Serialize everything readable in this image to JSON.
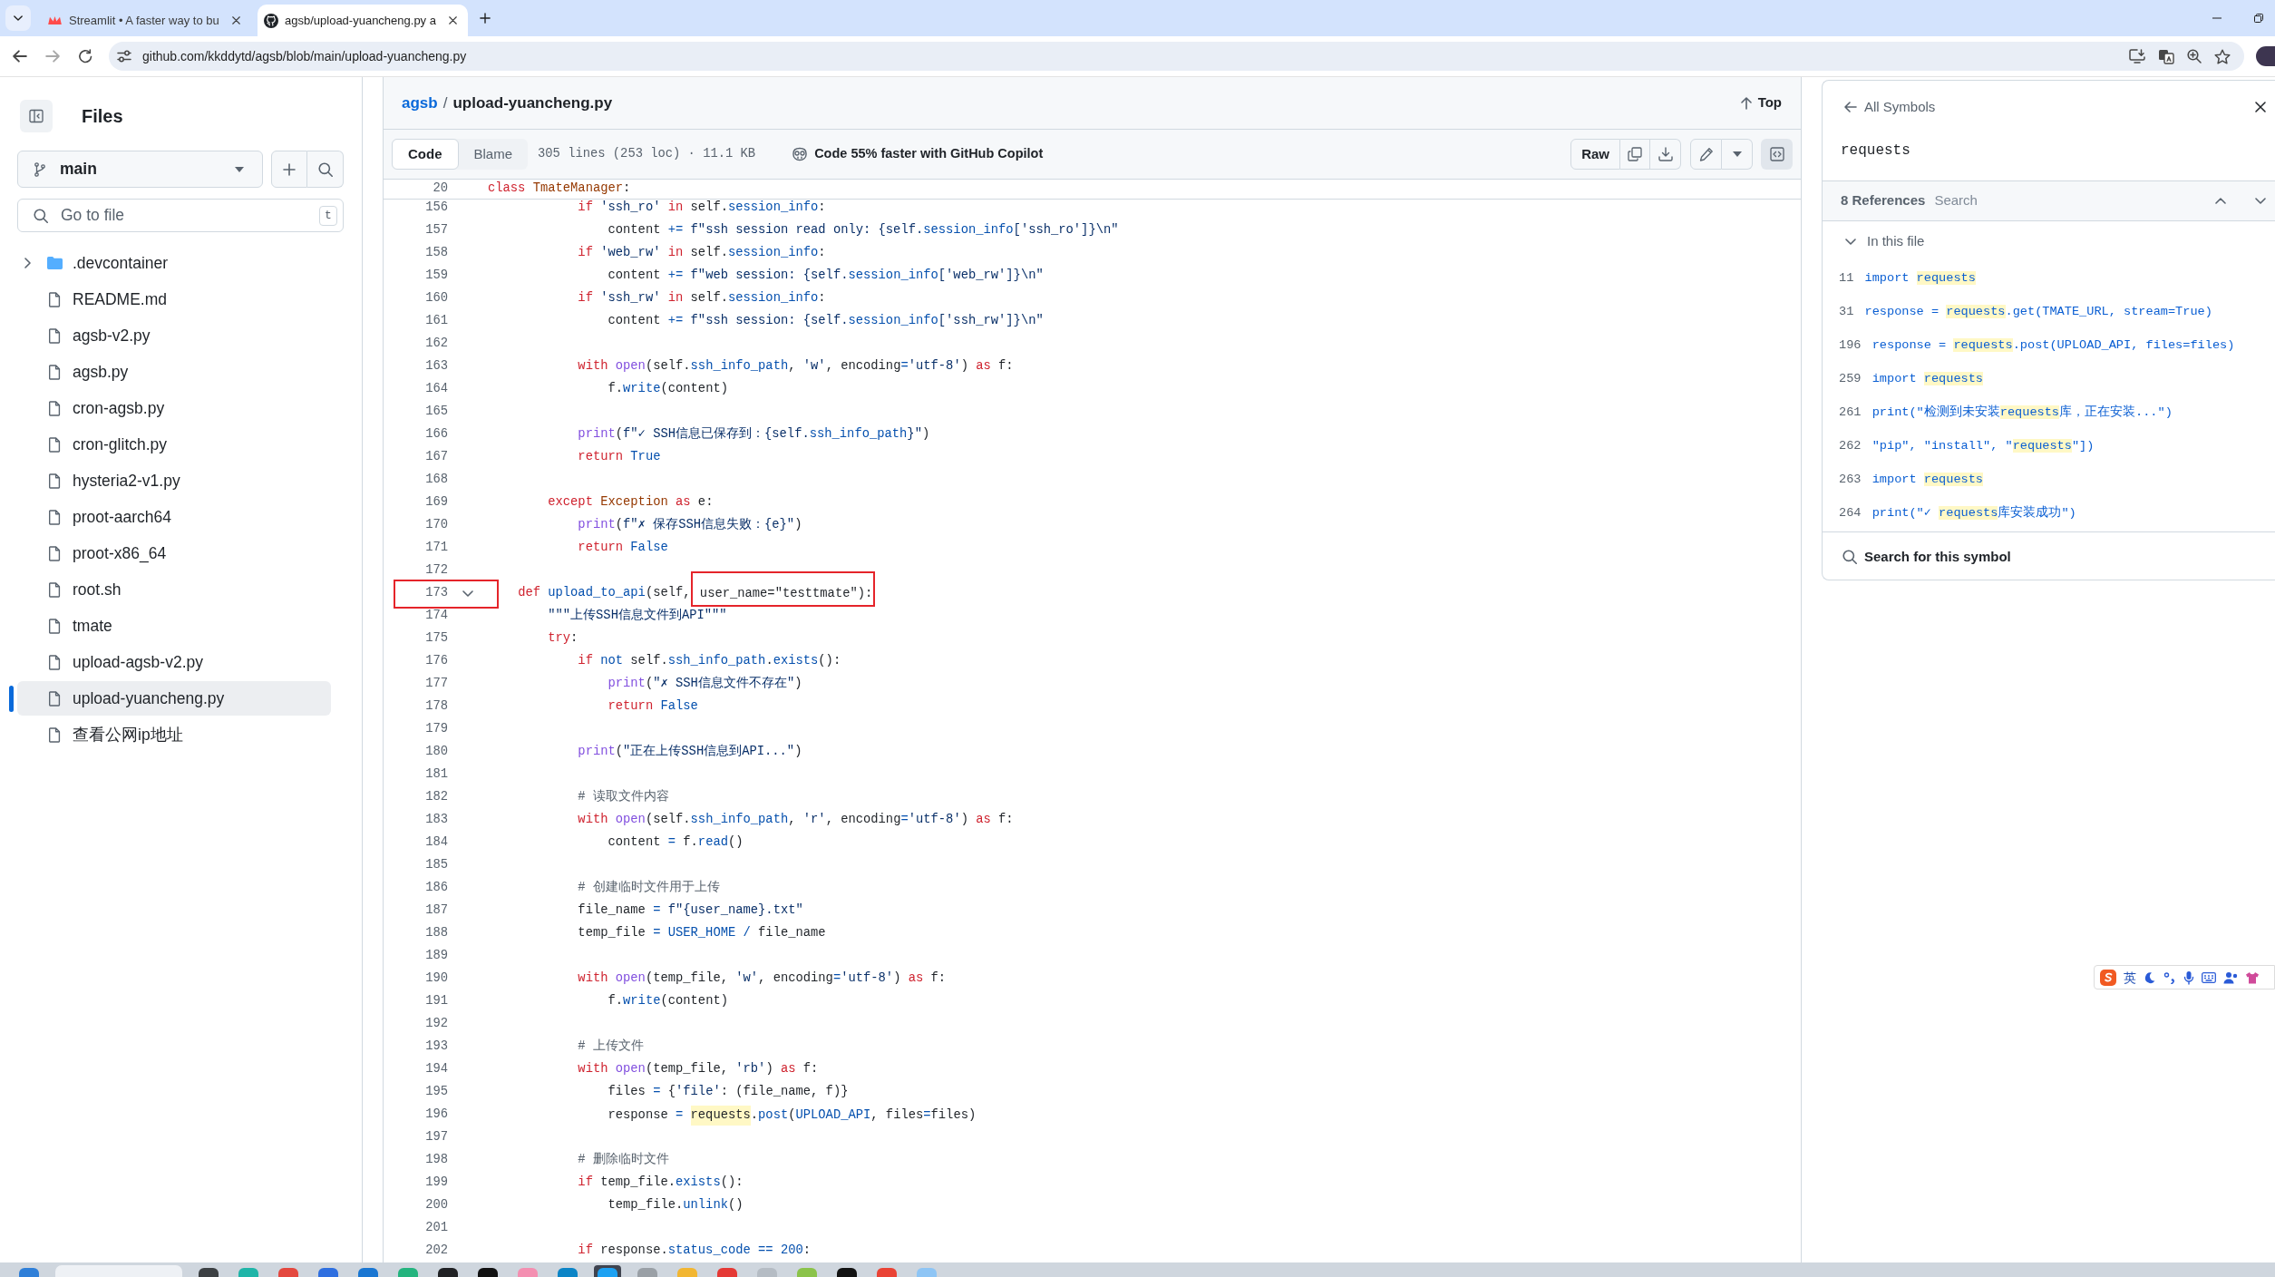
{
  "browser": {
    "tabs": [
      {
        "title": "Streamlit • A faster way to bu",
        "selected": false
      },
      {
        "title": "agsb/upload-yuancheng.py a",
        "selected": true
      }
    ],
    "address": "github.com/kkddytd/agsb/blob/main/upload-yuancheng.py"
  },
  "sidebar": {
    "title": "Files",
    "branch": "main",
    "file_search": {
      "placeholder": "Go to file",
      "shortcut": "t"
    },
    "tree": [
      {
        "name": ".devcontainer",
        "kind": "folder",
        "expanded": false,
        "selected": false
      },
      {
        "name": "README.md",
        "kind": "file",
        "selected": false
      },
      {
        "name": "agsb-v2.py",
        "kind": "file",
        "selected": false
      },
      {
        "name": "agsb.py",
        "kind": "file",
        "selected": false
      },
      {
        "name": "cron-agsb.py",
        "kind": "file",
        "selected": false
      },
      {
        "name": "cron-glitch.py",
        "kind": "file",
        "selected": false
      },
      {
        "name": "hysteria2-v1.py",
        "kind": "file",
        "selected": false
      },
      {
        "name": "proot-aarch64",
        "kind": "file",
        "selected": false
      },
      {
        "name": "proot-x86_64",
        "kind": "file",
        "selected": false
      },
      {
        "name": "root.sh",
        "kind": "file",
        "selected": false
      },
      {
        "name": "tmate",
        "kind": "file",
        "selected": false
      },
      {
        "name": "upload-agsb-v2.py",
        "kind": "file",
        "selected": false
      },
      {
        "name": "upload-yuancheng.py",
        "kind": "file",
        "selected": true
      },
      {
        "name": "查看公网ip地址",
        "kind": "file",
        "selected": false
      }
    ]
  },
  "file_header": {
    "breadcrumb": [
      {
        "label": "agsb",
        "kind": "link"
      },
      {
        "label": "upload-yuancheng.py",
        "kind": "current"
      }
    ],
    "separator": "/",
    "top_link": "Top"
  },
  "toolbar": {
    "view_tabs": [
      {
        "label": "Code",
        "selected": true
      },
      {
        "label": "Blame",
        "selected": false
      }
    ],
    "file_info": "305 lines (253 loc) · 11.1 KB",
    "copilot_promo": "Code 55% faster with GitHub Copilot",
    "raw_button": "Raw",
    "symbols_button": {
      "selected": true
    }
  },
  "code": {
    "sticky_line": {
      "number": "20",
      "tokens": [
        {
          "text": "class ",
          "kind": "keyword"
        },
        {
          "text": "TmateManager",
          "kind": "class"
        },
        {
          "text": ":",
          "kind": "plain"
        }
      ]
    },
    "lines": [
      {
        "number": "156",
        "tokens": [
          {
            "text": "            if",
            "kind": "keyword"
          },
          {
            "text": " 'ssh_ro' ",
            "kind": "string"
          },
          {
            "text": "in",
            "kind": "keyword"
          },
          {
            "text": " self.",
            "kind": "plain"
          },
          {
            "text": "session_info",
            "kind": "entity"
          },
          {
            "text": ":",
            "kind": "plain"
          }
        ]
      },
      {
        "number": "157",
        "tokens": [
          {
            "text": "                content ",
            "kind": "plain"
          },
          {
            "text": "+=",
            "kind": "entity"
          },
          {
            "text": " f\"ssh session read only: {self.",
            "kind": "string"
          },
          {
            "text": "session_info",
            "kind": "entity"
          },
          {
            "text": "['ssh_ro']}\\n\"",
            "kind": "string"
          }
        ]
      },
      {
        "number": "158",
        "tokens": [
          {
            "text": "            if",
            "kind": "keyword"
          },
          {
            "text": " 'web_rw' ",
            "kind": "string"
          },
          {
            "text": "in",
            "kind": "keyword"
          },
          {
            "text": " self.",
            "kind": "plain"
          },
          {
            "text": "session_info",
            "kind": "entity"
          },
          {
            "text": ":",
            "kind": "plain"
          }
        ]
      },
      {
        "number": "159",
        "tokens": [
          {
            "text": "                content ",
            "kind": "plain"
          },
          {
            "text": "+=",
            "kind": "entity"
          },
          {
            "text": " f\"web session: {self.",
            "kind": "string"
          },
          {
            "text": "session_info",
            "kind": "entity"
          },
          {
            "text": "['web_rw']}\\n\"",
            "kind": "string"
          }
        ]
      },
      {
        "number": "160",
        "tokens": [
          {
            "text": "            if",
            "kind": "keyword"
          },
          {
            "text": " 'ssh_rw' ",
            "kind": "string"
          },
          {
            "text": "in",
            "kind": "keyword"
          },
          {
            "text": " self.",
            "kind": "plain"
          },
          {
            "text": "session_info",
            "kind": "entity"
          },
          {
            "text": ":",
            "kind": "plain"
          }
        ]
      },
      {
        "number": "161",
        "tokens": [
          {
            "text": "                content ",
            "kind": "plain"
          },
          {
            "text": "+=",
            "kind": "entity"
          },
          {
            "text": " f\"ssh session: {self.",
            "kind": "string"
          },
          {
            "text": "session_info",
            "kind": "entity"
          },
          {
            "text": "['ssh_rw']}\\n\"",
            "kind": "string"
          }
        ]
      },
      {
        "number": "162"
      },
      {
        "number": "163",
        "tokens": [
          {
            "text": "            with ",
            "kind": "keyword"
          },
          {
            "text": "open",
            "kind": "builtin"
          },
          {
            "text": "(self.",
            "kind": "plain"
          },
          {
            "text": "ssh_info_path",
            "kind": "entity"
          },
          {
            "text": ", ",
            "kind": "plain"
          },
          {
            "text": "'w'",
            "kind": "string"
          },
          {
            "text": ", encoding",
            "kind": "plain"
          },
          {
            "text": "=",
            "kind": "entity"
          },
          {
            "text": "'utf-8'",
            "kind": "string"
          },
          {
            "text": ") ",
            "kind": "plain"
          },
          {
            "text": "as",
            "kind": "keyword"
          },
          {
            "text": " f:",
            "kind": "plain"
          }
        ]
      },
      {
        "number": "164",
        "tokens": [
          {
            "text": "                f.",
            "kind": "plain"
          },
          {
            "text": "write",
            "kind": "entity"
          },
          {
            "text": "(content)",
            "kind": "plain"
          }
        ]
      },
      {
        "number": "165"
      },
      {
        "number": "166",
        "tokens": [
          {
            "text": "            print",
            "kind": "builtin"
          },
          {
            "text": "(",
            "kind": "plain"
          },
          {
            "text": "f\"✓ SSH信息已保存到：{self.",
            "kind": "string"
          },
          {
            "text": "ssh_info_path",
            "kind": "entity"
          },
          {
            "text": "}\"",
            "kind": "string"
          },
          {
            "text": ")",
            "kind": "plain"
          }
        ]
      },
      {
        "number": "167",
        "tokens": [
          {
            "text": "            return ",
            "kind": "keyword"
          },
          {
            "text": "True",
            "kind": "entity"
          }
        ]
      },
      {
        "number": "168"
      },
      {
        "number": "169",
        "tokens": [
          {
            "text": "        except ",
            "kind": "keyword"
          },
          {
            "text": "Exception",
            "kind": "class"
          },
          {
            "text": " as",
            "kind": "keyword"
          },
          {
            "text": " e:",
            "kind": "plain"
          }
        ]
      },
      {
        "number": "170",
        "tokens": [
          {
            "text": "            print",
            "kind": "builtin"
          },
          {
            "text": "(",
            "kind": "plain"
          },
          {
            "text": "f\"✗ 保存SSH信息失败：{e}\"",
            "kind": "string"
          },
          {
            "text": ")",
            "kind": "plain"
          }
        ]
      },
      {
        "number": "171",
        "tokens": [
          {
            "text": "            return ",
            "kind": "keyword"
          },
          {
            "text": "False",
            "kind": "entity"
          }
        ]
      },
      {
        "number": "172"
      },
      {
        "number": "173",
        "fold": true,
        "boxed": true,
        "tokens": [
          {
            "text": "    def ",
            "kind": "keyword"
          },
          {
            "text": "upload_to_api",
            "kind": "entity"
          },
          {
            "text": "(self,",
            "kind": "plain"
          },
          {
            "text": " user_name=\"testtmate\"):",
            "kind": "boxed"
          }
        ]
      },
      {
        "number": "174",
        "tokens": [
          {
            "text": "        \"\"\"上传SSH信息文件到API\"\"\"",
            "kind": "string"
          }
        ]
      },
      {
        "number": "175",
        "tokens": [
          {
            "text": "        try",
            "kind": "keyword"
          },
          {
            "text": ":",
            "kind": "plain"
          }
        ]
      },
      {
        "number": "176",
        "tokens": [
          {
            "text": "            if ",
            "kind": "keyword"
          },
          {
            "text": "not",
            "kind": "entity"
          },
          {
            "text": " self.",
            "kind": "plain"
          },
          {
            "text": "ssh_info_path",
            "kind": "entity"
          },
          {
            "text": ".",
            "kind": "plain"
          },
          {
            "text": "exists",
            "kind": "entity"
          },
          {
            "text": "():",
            "kind": "plain"
          }
        ]
      },
      {
        "number": "177",
        "tokens": [
          {
            "text": "                print",
            "kind": "builtin"
          },
          {
            "text": "(",
            "kind": "plain"
          },
          {
            "text": "\"✗ SSH信息文件不存在\"",
            "kind": "string"
          },
          {
            "text": ")",
            "kind": "plain"
          }
        ]
      },
      {
        "number": "178",
        "tokens": [
          {
            "text": "                return ",
            "kind": "keyword"
          },
          {
            "text": "False",
            "kind": "entity"
          }
        ]
      },
      {
        "number": "179"
      },
      {
        "number": "180",
        "tokens": [
          {
            "text": "            print",
            "kind": "builtin"
          },
          {
            "text": "(",
            "kind": "plain"
          },
          {
            "text": "\"正在上传SSH信息到API...\"",
            "kind": "string"
          },
          {
            "text": ")",
            "kind": "plain"
          }
        ]
      },
      {
        "number": "181"
      },
      {
        "number": "182",
        "tokens": [
          {
            "text": "            # 读取文件内容",
            "kind": "comment"
          }
        ]
      },
      {
        "number": "183",
        "tokens": [
          {
            "text": "            with ",
            "kind": "keyword"
          },
          {
            "text": "open",
            "kind": "builtin"
          },
          {
            "text": "(self.",
            "kind": "plain"
          },
          {
            "text": "ssh_info_path",
            "kind": "entity"
          },
          {
            "text": ", ",
            "kind": "plain"
          },
          {
            "text": "'r'",
            "kind": "string"
          },
          {
            "text": ", encoding",
            "kind": "plain"
          },
          {
            "text": "=",
            "kind": "entity"
          },
          {
            "text": "'utf-8'",
            "kind": "string"
          },
          {
            "text": ") ",
            "kind": "plain"
          },
          {
            "text": "as",
            "kind": "keyword"
          },
          {
            "text": " f:",
            "kind": "plain"
          }
        ]
      },
      {
        "number": "184",
        "tokens": [
          {
            "text": "                content ",
            "kind": "plain"
          },
          {
            "text": "=",
            "kind": "entity"
          },
          {
            "text": " f.",
            "kind": "plain"
          },
          {
            "text": "read",
            "kind": "entity"
          },
          {
            "text": "()",
            "kind": "plain"
          }
        ]
      },
      {
        "number": "185"
      },
      {
        "number": "186",
        "tokens": [
          {
            "text": "            # 创建临时文件用于上传",
            "kind": "comment"
          }
        ]
      },
      {
        "number": "187",
        "tokens": [
          {
            "text": "            file_name ",
            "kind": "plain"
          },
          {
            "text": "=",
            "kind": "entity"
          },
          {
            "text": " f\"{user_name}.txt\"",
            "kind": "string"
          }
        ]
      },
      {
        "number": "188",
        "tokens": [
          {
            "text": "            temp_file ",
            "kind": "plain"
          },
          {
            "text": "= USER_HOME /",
            "kind": "entity"
          },
          {
            "text": " file_name",
            "kind": "plain"
          }
        ]
      },
      {
        "number": "189"
      },
      {
        "number": "190",
        "tokens": [
          {
            "text": "            with ",
            "kind": "keyword"
          },
          {
            "text": "open",
            "kind": "builtin"
          },
          {
            "text": "(temp_file, ",
            "kind": "plain"
          },
          {
            "text": "'w'",
            "kind": "string"
          },
          {
            "text": ", encoding",
            "kind": "plain"
          },
          {
            "text": "=",
            "kind": "entity"
          },
          {
            "text": "'utf-8'",
            "kind": "string"
          },
          {
            "text": ") ",
            "kind": "plain"
          },
          {
            "text": "as",
            "kind": "keyword"
          },
          {
            "text": " f:",
            "kind": "plain"
          }
        ]
      },
      {
        "number": "191",
        "tokens": [
          {
            "text": "                f.",
            "kind": "plain"
          },
          {
            "text": "write",
            "kind": "entity"
          },
          {
            "text": "(content)",
            "kind": "plain"
          }
        ]
      },
      {
        "number": "192"
      },
      {
        "number": "193",
        "tokens": [
          {
            "text": "            # 上传文件",
            "kind": "comment"
          }
        ]
      },
      {
        "number": "194",
        "tokens": [
          {
            "text": "            with ",
            "kind": "keyword"
          },
          {
            "text": "open",
            "kind": "builtin"
          },
          {
            "text": "(temp_file, ",
            "kind": "plain"
          },
          {
            "text": "'rb'",
            "kind": "string"
          },
          {
            "text": ") ",
            "kind": "plain"
          },
          {
            "text": "as",
            "kind": "keyword"
          },
          {
            "text": " f:",
            "kind": "plain"
          }
        ]
      },
      {
        "number": "195",
        "tokens": [
          {
            "text": "                files ",
            "kind": "plain"
          },
          {
            "text": "=",
            "kind": "entity"
          },
          {
            "text": " {",
            "kind": "plain"
          },
          {
            "text": "'file'",
            "kind": "string"
          },
          {
            "text": ": (file_name, f)}",
            "kind": "plain"
          }
        ]
      },
      {
        "number": "196",
        "tokens": [
          {
            "text": "                response ",
            "kind": "plain"
          },
          {
            "text": "= ",
            "kind": "entity"
          },
          {
            "text": "requests",
            "kind": "match"
          },
          {
            "text": ".",
            "kind": "plain"
          },
          {
            "text": "post",
            "kind": "entity"
          },
          {
            "text": "(",
            "kind": "plain"
          },
          {
            "text": "UPLOAD_API",
            "kind": "entity"
          },
          {
            "text": ", files",
            "kind": "plain"
          },
          {
            "text": "=",
            "kind": "entity"
          },
          {
            "text": "files)",
            "kind": "plain"
          }
        ]
      },
      {
        "number": "197"
      },
      {
        "number": "198",
        "tokens": [
          {
            "text": "            # 删除临时文件",
            "kind": "comment"
          }
        ]
      },
      {
        "number": "199",
        "tokens": [
          {
            "text": "            if",
            "kind": "keyword"
          },
          {
            "text": " temp_file.",
            "kind": "plain"
          },
          {
            "text": "exists",
            "kind": "entity"
          },
          {
            "text": "():",
            "kind": "plain"
          }
        ]
      },
      {
        "number": "200",
        "tokens": [
          {
            "text": "                temp_file.",
            "kind": "plain"
          },
          {
            "text": "unlink",
            "kind": "entity"
          },
          {
            "text": "()",
            "kind": "plain"
          }
        ]
      },
      {
        "number": "201"
      },
      {
        "number": "202",
        "tokens": [
          {
            "text": "            if",
            "kind": "keyword"
          },
          {
            "text": " response.",
            "kind": "plain"
          },
          {
            "text": "status_code",
            "kind": "entity"
          },
          {
            "text": " == 200",
            "kind": "entity"
          },
          {
            "text": ":",
            "kind": "plain"
          }
        ]
      }
    ]
  },
  "symbols_panel": {
    "back_link": "All Symbols",
    "symbol": "requests",
    "references_count": "8 References",
    "search_label": "Search",
    "group": {
      "label": "In this file",
      "expanded": true,
      "references": [
        {
          "number": "11",
          "tokens": [
            {
              "text": "import ",
              "kind": "plain"
            },
            {
              "text": "requests",
              "kind": "match"
            }
          ]
        },
        {
          "number": "31",
          "tokens": [
            {
              "text": "response = ",
              "kind": "plain"
            },
            {
              "text": "requests",
              "kind": "match"
            },
            {
              "text": ".get(TMATE_URL, stream=True)",
              "kind": "plain"
            }
          ]
        },
        {
          "number": "196",
          "tokens": [
            {
              "text": "response = ",
              "kind": "plain"
            },
            {
              "text": "requests",
              "kind": "match"
            },
            {
              "text": ".post(UPLOAD_API, files=files)",
              "kind": "plain"
            }
          ]
        },
        {
          "number": "259",
          "tokens": [
            {
              "text": "import ",
              "kind": "plain"
            },
            {
              "text": "requests",
              "kind": "match"
            }
          ]
        },
        {
          "number": "261",
          "tokens": [
            {
              "text": "print(\"检测到未安装",
              "kind": "plain"
            },
            {
              "text": "requests",
              "kind": "match"
            },
            {
              "text": "库，正在安装...\")",
              "kind": "plain"
            }
          ]
        },
        {
          "number": "262",
          "tokens": [
            {
              "text": "\"pip\", \"install\", \"",
              "kind": "plain"
            },
            {
              "text": "requests",
              "kind": "match"
            },
            {
              "text": "\"])",
              "kind": "plain"
            }
          ]
        },
        {
          "number": "263",
          "tokens": [
            {
              "text": "import ",
              "kind": "plain"
            },
            {
              "text": "requests",
              "kind": "match"
            }
          ]
        },
        {
          "number": "264",
          "tokens": [
            {
              "text": "print(\"✓ ",
              "kind": "plain"
            },
            {
              "text": "requests",
              "kind": "match"
            },
            {
              "text": "库安装成功\")",
              "kind": "plain"
            }
          ]
        }
      ]
    },
    "search_symbol": "Search for this symbol"
  },
  "ime_toolbar": {
    "mode": "英"
  },
  "taskbar": {
    "items": [
      {
        "kind": "app",
        "color": "#2f7fd8",
        "selected": false
      },
      {
        "kind": "search"
      },
      {
        "kind": "app",
        "color": "#3c4043",
        "selected": false
      },
      {
        "kind": "app",
        "color": "#1fb5a8",
        "selected": false
      },
      {
        "kind": "app",
        "color": "#e4483f",
        "selected": false
      },
      {
        "kind": "app",
        "color": "#2f6fe0",
        "selected": false
      },
      {
        "kind": "app",
        "color": "#1976d2",
        "selected": false
      },
      {
        "kind": "app",
        "color": "#24b47e",
        "selected": false
      },
      {
        "kind": "app",
        "color": "#202124",
        "selected": false
      },
      {
        "kind": "app",
        "color": "#111111",
        "selected": false
      },
      {
        "kind": "app",
        "color": "#f48fb1",
        "selected": false
      },
      {
        "kind": "app",
        "color": "#0b84c6",
        "selected": false
      },
      {
        "kind": "app",
        "color": "#1da1f2",
        "selected": true
      },
      {
        "kind": "app",
        "color": "#9aa0a6",
        "selected": false
      },
      {
        "kind": "app",
        "color": "#f2b632",
        "selected": false
      },
      {
        "kind": "app",
        "color": "#e53935",
        "selected": false
      },
      {
        "kind": "app",
        "color": "#b5bcc4",
        "selected": false
      },
      {
        "kind": "app",
        "color": "#8bc34a",
        "selected": false
      },
      {
        "kind": "app",
        "color": "#121212",
        "selected": false
      },
      {
        "kind": "app",
        "color": "#ea4335",
        "selected": false
      },
      {
        "kind": "app",
        "color": "#8ec5f5",
        "selected": false
      }
    ]
  }
}
